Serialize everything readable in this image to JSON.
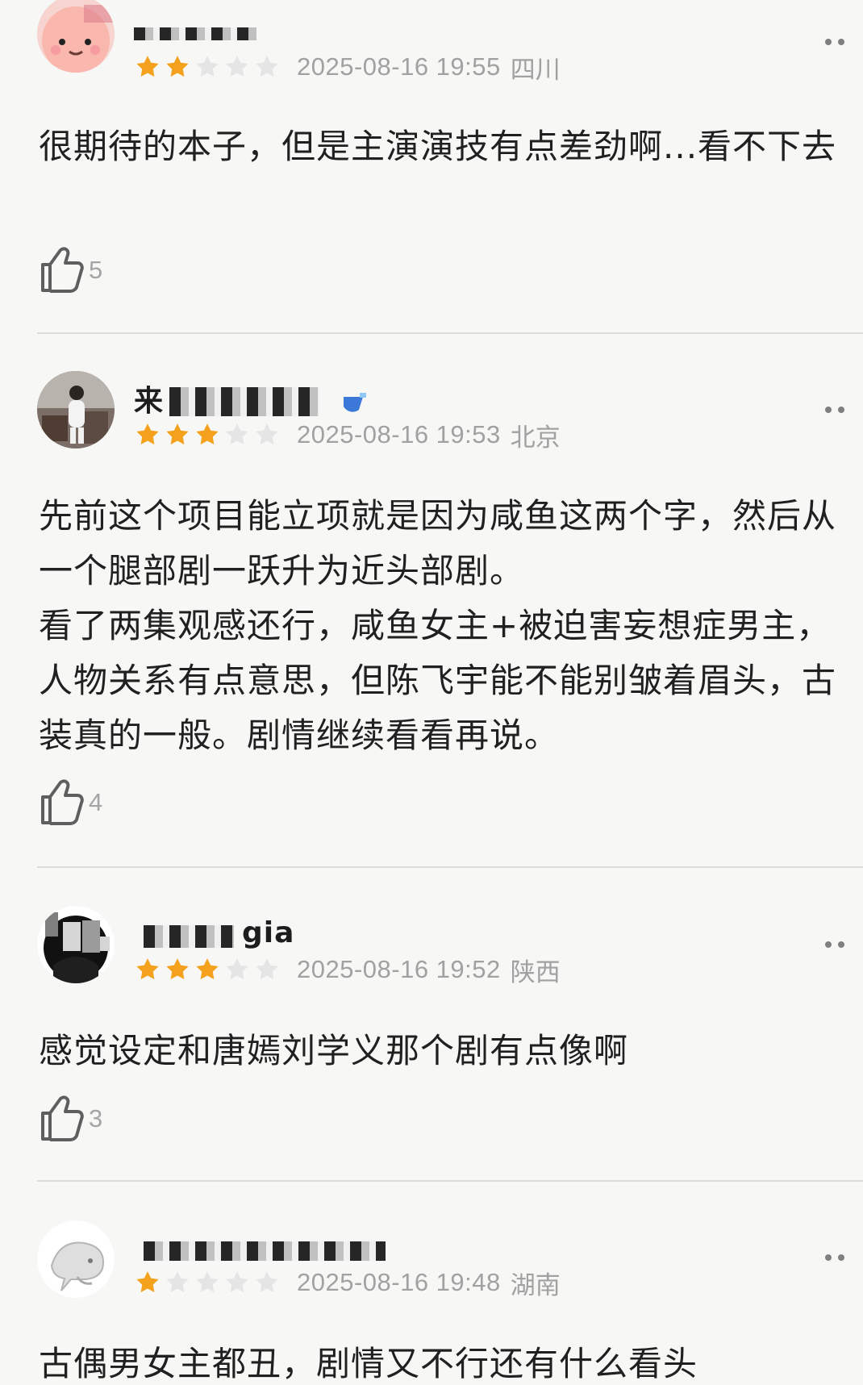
{
  "comments": [
    {
      "username": "",
      "rating": 2,
      "date": "2025-08-16 19:55",
      "location": "四川",
      "content": "很期待的本子，但是主演演技有点差劲啊...看不下去",
      "likes": "5",
      "avatar": "pink-cartoon-avatar"
    },
    {
      "username": "来",
      "rating": 3,
      "date": "2025-08-16 19:53",
      "location": "北京",
      "content": "先前这个项目能立项就是因为咸鱼这两个字，然后从一个腿部剧一跃升为近头部剧。\n看了两集观感还行，咸鱼女主+被迫害妄想症男主，人物关系有点意思，但陈飞宇能不能别皱着眉头，古装真的一般。剧情继续看看再说。",
      "likes": "4",
      "avatar": "photo-avatar"
    },
    {
      "username": "gia",
      "rating": 3,
      "date": "2025-08-16 19:52",
      "location": "陕西",
      "content": "感觉设定和唐嫣刘学义那个剧有点像啊",
      "likes": "3",
      "avatar": "dark-photo-avatar"
    },
    {
      "username": "",
      "rating": 1,
      "date": "2025-08-16 19:48",
      "location": "湖南",
      "content": "古偶男女主都丑，剧情又不行还有什么看头",
      "likes": "",
      "avatar": "whale-avatar"
    }
  ],
  "colors": {
    "star_filled": "#f4a11d",
    "star_empty": "#e5e5e5",
    "meta_text": "#a1a1a1",
    "divider": "#dcdcdc"
  },
  "icons": {
    "like": "thumbs-up-icon",
    "more": "more-options-icon",
    "star": "star-icon"
  }
}
